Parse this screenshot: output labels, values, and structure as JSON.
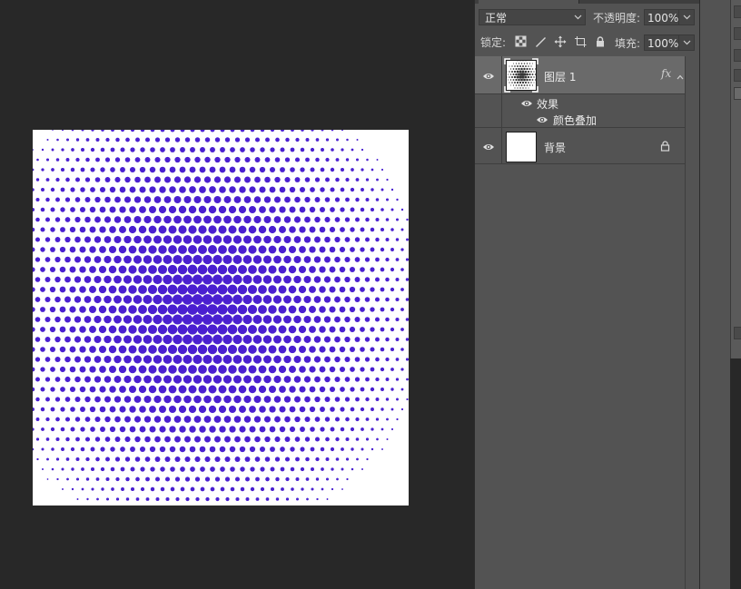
{
  "layers_panel": {
    "blend_mode": "正常",
    "opacity_label": "不透明度:",
    "opacity_value": "100%",
    "lock_label": "锁定:",
    "lock_icons": [
      "lock-transparent-pixels-icon",
      "lock-image-pixels-icon",
      "lock-position-icon",
      "lock-artboard-icon",
      "lock-all-icon"
    ],
    "fill_label": "填充:",
    "fill_value": "100%",
    "layers": [
      {
        "name": "图层 1",
        "fx_badge": "fx",
        "selected": true,
        "visible": true,
        "effects_label": "效果",
        "effects": [
          "颜色叠加"
        ]
      },
      {
        "name": "背景",
        "locked": true,
        "visible": true
      }
    ]
  },
  "canvas": {
    "background_color": "#ffffff",
    "dot_color": "#4a1fd0",
    "pattern": "radial halftone dot gradient"
  },
  "colors": {
    "workspace": "#282828",
    "panel": "#535353",
    "selected_row": "#6a6a6a"
  }
}
